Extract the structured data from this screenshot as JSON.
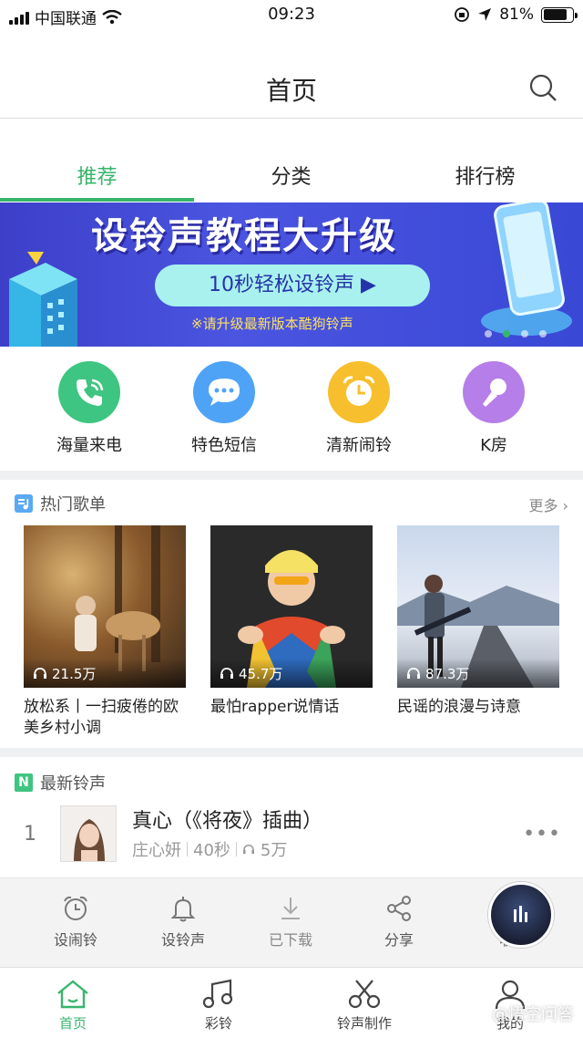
{
  "status_bar": {
    "carrier": "中国联通",
    "time": "09:23",
    "battery": "81%",
    "battery_level": 0.81
  },
  "header": {
    "title": "首页",
    "search_icon": "search-icon"
  },
  "tabs": [
    {
      "label": "推荐",
      "active": true
    },
    {
      "label": "分类",
      "active": false
    },
    {
      "label": "排行榜",
      "active": false
    }
  ],
  "banner": {
    "title": "设铃声教程大升级",
    "button_label": "10秒轻松设铃声 ▶",
    "note": "※请升级最新版本酷狗铃声",
    "page_count": 4,
    "active_page": 2
  },
  "features": [
    {
      "label": "海量来电",
      "icon": "phone-icon",
      "color": "#3ec581"
    },
    {
      "label": "特色短信",
      "icon": "message-icon",
      "color": "#4fa3f7"
    },
    {
      "label": "清新闹铃",
      "icon": "alarm-clock-icon",
      "color": "#f7bf2e"
    },
    {
      "label": "K房",
      "icon": "microphone-icon",
      "color": "#b67ee8"
    }
  ],
  "hot_playlists": {
    "title": "热门歌单",
    "more_label": "更多",
    "items": [
      {
        "name": "放松系丨一扫疲倦的欧美乡村小调",
        "plays": "21.5万"
      },
      {
        "name": "最怕rapper说情话",
        "plays": "45.7万"
      },
      {
        "name": "民谣的浪漫与诗意",
        "plays": "87.3万"
      }
    ]
  },
  "newest_ringtones": {
    "title": "最新铃声",
    "badge": "N",
    "items": [
      {
        "rank": "1",
        "title": "真心（《将夜》插曲）",
        "artist": "庄心妍",
        "duration": "40秒",
        "plays": "5万"
      }
    ]
  },
  "action_bar": [
    {
      "label": "设闹铃",
      "icon": "alarm-icon"
    },
    {
      "label": "设铃声",
      "icon": "bell-icon"
    },
    {
      "label": "已下载",
      "icon": "download-icon"
    },
    {
      "label": "分享",
      "icon": "share-icon"
    },
    {
      "label": "收",
      "icon": "favorite-icon"
    }
  ],
  "bottom_nav": [
    {
      "label": "首页",
      "icon": "home-icon",
      "active": true
    },
    {
      "label": "彩铃",
      "icon": "music-note-icon",
      "active": false
    },
    {
      "label": "铃声制作",
      "icon": "scissors-icon",
      "active": false
    },
    {
      "label": "我的",
      "icon": "user-icon",
      "active": false
    }
  ],
  "watermark": "@悟空问答",
  "colors": {
    "accent": "#37b56b",
    "banner": "#4a55e0"
  }
}
